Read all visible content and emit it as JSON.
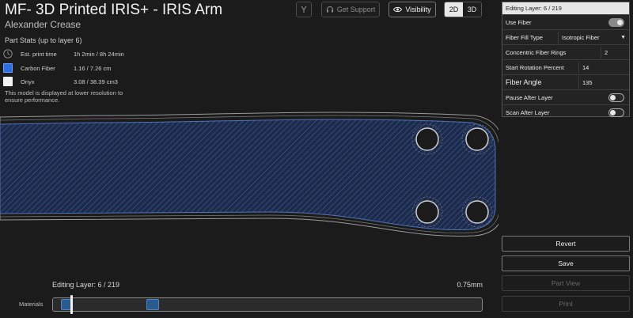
{
  "header": {
    "title": "MF- 3D Printed IRIS+ - IRIS Arm",
    "author": "Alexander Crease"
  },
  "stats": {
    "heading": "Part Stats (up to layer 6)",
    "rows": [
      {
        "icon": "clock-icon",
        "label": "Est. print time",
        "value": "1h 2min / 8h 24min"
      },
      {
        "icon": "carbon-fiber-swatch",
        "label": "Carbon Fiber",
        "value": "1.16 / 7.26 cm"
      },
      {
        "icon": "onyx-swatch",
        "label": "Onyx",
        "value": "3.08 / 38.39 cm3"
      }
    ],
    "note": "This model is displayed at lower resolution to ensure performance."
  },
  "toolbar": {
    "support_label": "Get Support",
    "visibility_label": "Visibility",
    "view_2d": "2D",
    "view_3d": "3D",
    "active_view": "2D"
  },
  "panel": {
    "header": "Editing Layer: 6 / 219",
    "use_fiber_label": "Use Fiber",
    "use_fiber_on": true,
    "fill_type_label": "Fiber Fill Type",
    "fill_type_value": "Isotropic Fiber",
    "rings_label": "Concentric Fiber Rings",
    "rings_value": "2",
    "rotation_label": "Start Rotation Percent",
    "rotation_value": "14",
    "angle_label": "Fiber Angle",
    "angle_value": "135",
    "pause_label": "Pause After Layer",
    "pause_on": false,
    "scan_label": "Scan After Layer",
    "scan_on": false
  },
  "actions": {
    "revert": "Revert",
    "save": "Save",
    "part_view": "Part View",
    "print": "Print"
  },
  "slider": {
    "label": "Editing Layer: 6 / 219",
    "thickness": "0.75mm",
    "materials_label": "Materials",
    "current_layer": 6,
    "total_layers": 219
  },
  "colors": {
    "fiber_blue": "#2e6fe0",
    "onyx_white": "#f2f2f2",
    "background": "#1b1b1b"
  }
}
